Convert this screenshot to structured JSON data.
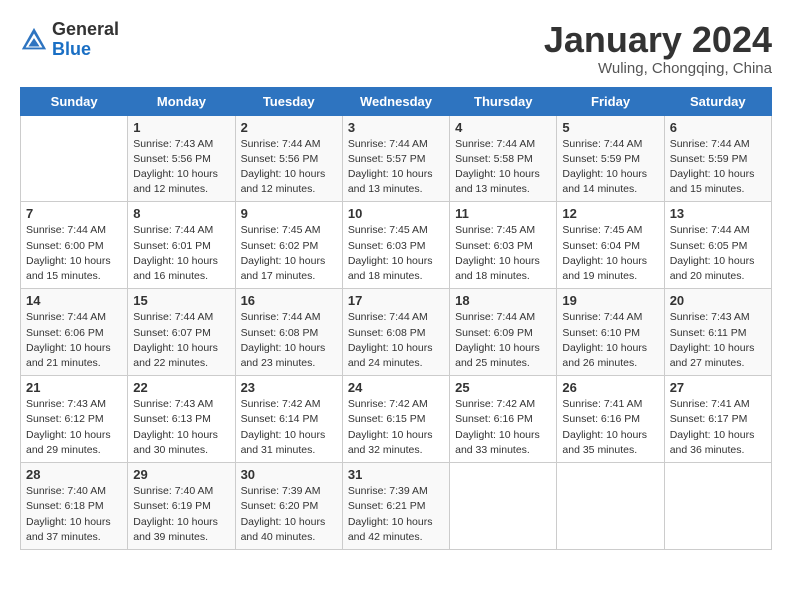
{
  "header": {
    "logo_general": "General",
    "logo_blue": "Blue",
    "title": "January 2024",
    "subtitle": "Wuling, Chongqing, China"
  },
  "weekdays": [
    "Sunday",
    "Monday",
    "Tuesday",
    "Wednesday",
    "Thursday",
    "Friday",
    "Saturday"
  ],
  "weeks": [
    [
      {
        "day": "",
        "sunrise": "",
        "sunset": "",
        "daylight": ""
      },
      {
        "day": "1",
        "sunrise": "Sunrise: 7:43 AM",
        "sunset": "Sunset: 5:56 PM",
        "daylight": "Daylight: 10 hours and 12 minutes."
      },
      {
        "day": "2",
        "sunrise": "Sunrise: 7:44 AM",
        "sunset": "Sunset: 5:56 PM",
        "daylight": "Daylight: 10 hours and 12 minutes."
      },
      {
        "day": "3",
        "sunrise": "Sunrise: 7:44 AM",
        "sunset": "Sunset: 5:57 PM",
        "daylight": "Daylight: 10 hours and 13 minutes."
      },
      {
        "day": "4",
        "sunrise": "Sunrise: 7:44 AM",
        "sunset": "Sunset: 5:58 PM",
        "daylight": "Daylight: 10 hours and 13 minutes."
      },
      {
        "day": "5",
        "sunrise": "Sunrise: 7:44 AM",
        "sunset": "Sunset: 5:59 PM",
        "daylight": "Daylight: 10 hours and 14 minutes."
      },
      {
        "day": "6",
        "sunrise": "Sunrise: 7:44 AM",
        "sunset": "Sunset: 5:59 PM",
        "daylight": "Daylight: 10 hours and 15 minutes."
      }
    ],
    [
      {
        "day": "7",
        "sunrise": "Sunrise: 7:44 AM",
        "sunset": "Sunset: 6:00 PM",
        "daylight": "Daylight: 10 hours and 15 minutes."
      },
      {
        "day": "8",
        "sunrise": "Sunrise: 7:44 AM",
        "sunset": "Sunset: 6:01 PM",
        "daylight": "Daylight: 10 hours and 16 minutes."
      },
      {
        "day": "9",
        "sunrise": "Sunrise: 7:45 AM",
        "sunset": "Sunset: 6:02 PM",
        "daylight": "Daylight: 10 hours and 17 minutes."
      },
      {
        "day": "10",
        "sunrise": "Sunrise: 7:45 AM",
        "sunset": "Sunset: 6:03 PM",
        "daylight": "Daylight: 10 hours and 18 minutes."
      },
      {
        "day": "11",
        "sunrise": "Sunrise: 7:45 AM",
        "sunset": "Sunset: 6:03 PM",
        "daylight": "Daylight: 10 hours and 18 minutes."
      },
      {
        "day": "12",
        "sunrise": "Sunrise: 7:45 AM",
        "sunset": "Sunset: 6:04 PM",
        "daylight": "Daylight: 10 hours and 19 minutes."
      },
      {
        "day": "13",
        "sunrise": "Sunrise: 7:44 AM",
        "sunset": "Sunset: 6:05 PM",
        "daylight": "Daylight: 10 hours and 20 minutes."
      }
    ],
    [
      {
        "day": "14",
        "sunrise": "Sunrise: 7:44 AM",
        "sunset": "Sunset: 6:06 PM",
        "daylight": "Daylight: 10 hours and 21 minutes."
      },
      {
        "day": "15",
        "sunrise": "Sunrise: 7:44 AM",
        "sunset": "Sunset: 6:07 PM",
        "daylight": "Daylight: 10 hours and 22 minutes."
      },
      {
        "day": "16",
        "sunrise": "Sunrise: 7:44 AM",
        "sunset": "Sunset: 6:08 PM",
        "daylight": "Daylight: 10 hours and 23 minutes."
      },
      {
        "day": "17",
        "sunrise": "Sunrise: 7:44 AM",
        "sunset": "Sunset: 6:08 PM",
        "daylight": "Daylight: 10 hours and 24 minutes."
      },
      {
        "day": "18",
        "sunrise": "Sunrise: 7:44 AM",
        "sunset": "Sunset: 6:09 PM",
        "daylight": "Daylight: 10 hours and 25 minutes."
      },
      {
        "day": "19",
        "sunrise": "Sunrise: 7:44 AM",
        "sunset": "Sunset: 6:10 PM",
        "daylight": "Daylight: 10 hours and 26 minutes."
      },
      {
        "day": "20",
        "sunrise": "Sunrise: 7:43 AM",
        "sunset": "Sunset: 6:11 PM",
        "daylight": "Daylight: 10 hours and 27 minutes."
      }
    ],
    [
      {
        "day": "21",
        "sunrise": "Sunrise: 7:43 AM",
        "sunset": "Sunset: 6:12 PM",
        "daylight": "Daylight: 10 hours and 29 minutes."
      },
      {
        "day": "22",
        "sunrise": "Sunrise: 7:43 AM",
        "sunset": "Sunset: 6:13 PM",
        "daylight": "Daylight: 10 hours and 30 minutes."
      },
      {
        "day": "23",
        "sunrise": "Sunrise: 7:42 AM",
        "sunset": "Sunset: 6:14 PM",
        "daylight": "Daylight: 10 hours and 31 minutes."
      },
      {
        "day": "24",
        "sunrise": "Sunrise: 7:42 AM",
        "sunset": "Sunset: 6:15 PM",
        "daylight": "Daylight: 10 hours and 32 minutes."
      },
      {
        "day": "25",
        "sunrise": "Sunrise: 7:42 AM",
        "sunset": "Sunset: 6:16 PM",
        "daylight": "Daylight: 10 hours and 33 minutes."
      },
      {
        "day": "26",
        "sunrise": "Sunrise: 7:41 AM",
        "sunset": "Sunset: 6:16 PM",
        "daylight": "Daylight: 10 hours and 35 minutes."
      },
      {
        "day": "27",
        "sunrise": "Sunrise: 7:41 AM",
        "sunset": "Sunset: 6:17 PM",
        "daylight": "Daylight: 10 hours and 36 minutes."
      }
    ],
    [
      {
        "day": "28",
        "sunrise": "Sunrise: 7:40 AM",
        "sunset": "Sunset: 6:18 PM",
        "daylight": "Daylight: 10 hours and 37 minutes."
      },
      {
        "day": "29",
        "sunrise": "Sunrise: 7:40 AM",
        "sunset": "Sunset: 6:19 PM",
        "daylight": "Daylight: 10 hours and 39 minutes."
      },
      {
        "day": "30",
        "sunrise": "Sunrise: 7:39 AM",
        "sunset": "Sunset: 6:20 PM",
        "daylight": "Daylight: 10 hours and 40 minutes."
      },
      {
        "day": "31",
        "sunrise": "Sunrise: 7:39 AM",
        "sunset": "Sunset: 6:21 PM",
        "daylight": "Daylight: 10 hours and 42 minutes."
      },
      {
        "day": "",
        "sunrise": "",
        "sunset": "",
        "daylight": ""
      },
      {
        "day": "",
        "sunrise": "",
        "sunset": "",
        "daylight": ""
      },
      {
        "day": "",
        "sunrise": "",
        "sunset": "",
        "daylight": ""
      }
    ]
  ]
}
